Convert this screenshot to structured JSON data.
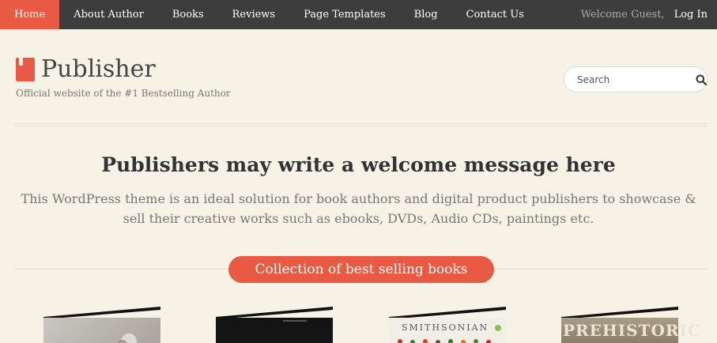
{
  "nav": {
    "items": [
      "Home",
      "About Author",
      "Books",
      "Reviews",
      "Page Templates",
      "Blog",
      "Contact Us"
    ],
    "active_index": 0,
    "welcome": "Welcome Guest,",
    "login": "Log In"
  },
  "header": {
    "logo_text": "Publisher",
    "tagline": "Official website of the #1 Bestselling Author"
  },
  "search": {
    "placeholder": "Search"
  },
  "welcome": {
    "title": "Publishers may write a welcome message here",
    "text": "This WordPress theme is an ideal solution for book authors and digital product publishers to showcase & sell their creative works such as ebooks, DVDs, Audio CDs, paintings etc."
  },
  "collection": {
    "label": "Collection of best selling books"
  },
  "books": [
    {
      "cover_color": "#b9b5ad"
    },
    {
      "cover_color": "#151515"
    },
    {
      "cover_color": "#f0ede6",
      "title": "SMITHSONIAN"
    },
    {
      "cover_color": "#9c8f7c",
      "title": "PREHISTORIC"
    }
  ],
  "colors": {
    "accent": "#e95a44",
    "nav_bg": "#3d3d3d",
    "page_bg": "#f7f2e6"
  }
}
